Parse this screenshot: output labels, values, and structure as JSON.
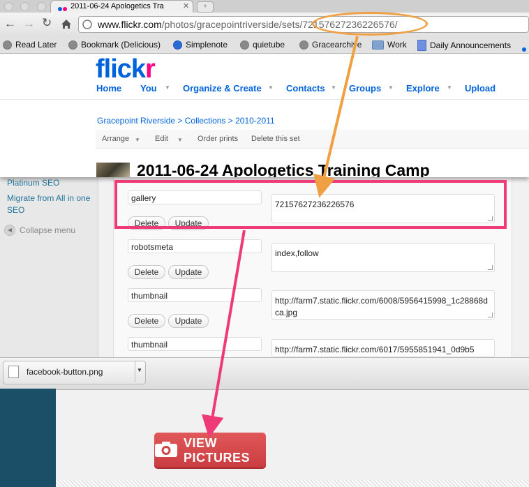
{
  "browser": {
    "tab_title": "2011-06-24 Apologetics Tra",
    "url_host": "www.flickr.com",
    "url_path": "/photos/gracepointriverside/sets/",
    "url_id": "72157627236226576",
    "url_tail": "/",
    "bookmarks": [
      {
        "label": "Read Later",
        "icon": "globe-icon"
      },
      {
        "label": "Bookmark (Delicious)",
        "icon": "globe-icon"
      },
      {
        "label": "Simplenote",
        "icon": "simplenote-icon"
      },
      {
        "label": "quietube",
        "icon": "globe-icon"
      },
      {
        "label": "Gracearchive",
        "icon": "globe-icon"
      },
      {
        "label": "Work",
        "icon": "folder-icon"
      },
      {
        "label": "Daily Announcements",
        "icon": "document-icon"
      }
    ]
  },
  "flickr": {
    "logo_blue": "flick",
    "logo_pink": "r",
    "nav": [
      "Home",
      "You",
      "Organize & Create",
      "Contacts",
      "Groups",
      "Explore",
      "Upload"
    ],
    "breadcrumb": "Gracepoint Riverside > Collections > 2010-2011",
    "subnav": [
      "Arrange",
      "Edit",
      "Order prints",
      "Delete this set"
    ],
    "set_title": "2011-06-24 Apologetics Training Camp"
  },
  "wp": {
    "menu": {
      "items": [
        "Platinum SEO",
        "Migrate from All in one",
        "SEO"
      ],
      "collapse": "Collapse menu"
    },
    "custom_fields": [
      {
        "key": "gallery",
        "value": "72157627236226576"
      },
      {
        "key": "robotsmeta",
        "value": "index,follow"
      },
      {
        "key": "thumbnail",
        "value": "http://farm7.static.flickr.com/6008/5956415998_1c28868dca.jpg"
      },
      {
        "key": "thumbnail",
        "value": "http://farm7.static.flickr.com/6017/5955851941_0d9b5"
      }
    ],
    "delete_label": "Delete",
    "update_label": "Update"
  },
  "download": {
    "filename": "facebook-button.png"
  },
  "view_button": {
    "label": "VIEW PICTURES",
    "icon": "camera-icon"
  },
  "colors": {
    "flickr_blue": "#0063dc",
    "flickr_pink": "#ff0084",
    "annotation_orange": "#f0a043",
    "annotation_pink": "#ef3a78",
    "button_red": "#d04548"
  }
}
